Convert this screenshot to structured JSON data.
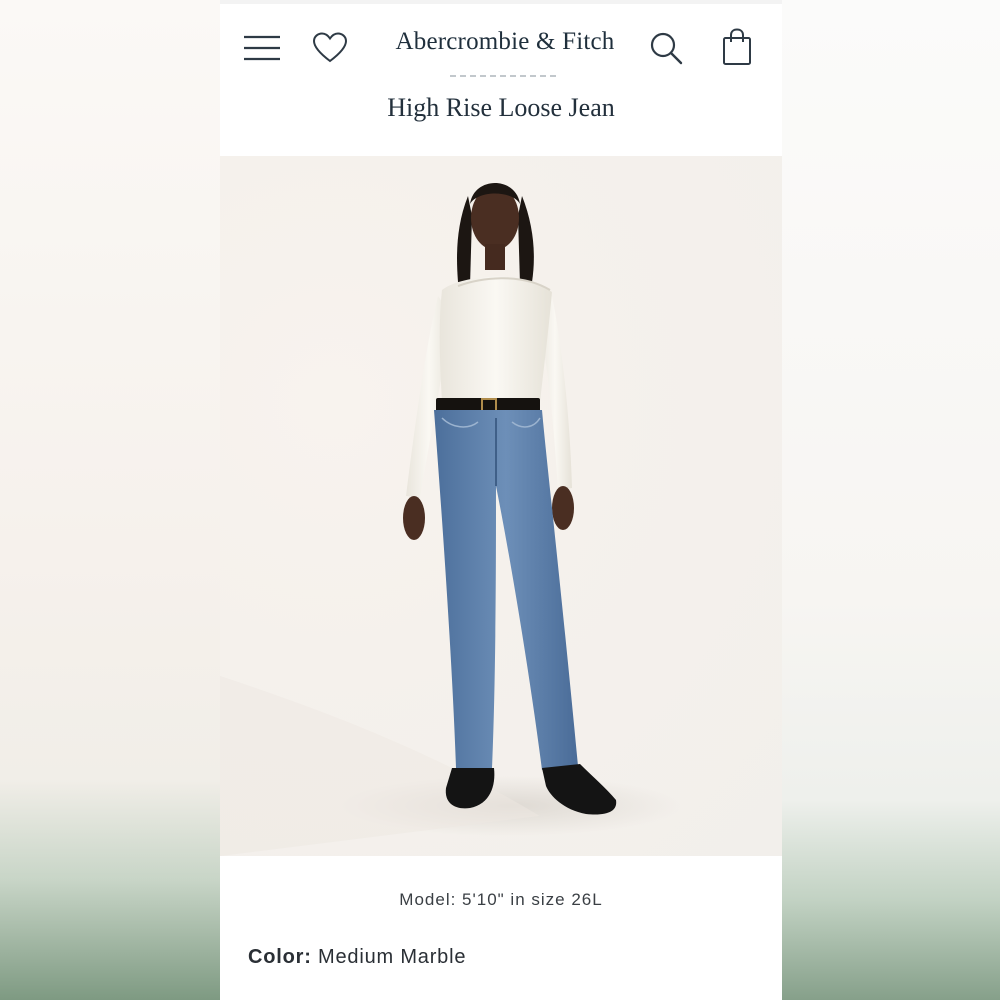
{
  "header": {
    "brand": "Abercrombie & Fitch",
    "icons": {
      "menu": "hamburger-menu-icon",
      "wishlist": "heart-icon",
      "search": "search-icon",
      "bag": "shopping-bag-icon"
    }
  },
  "product": {
    "title": "High Rise Loose Jean",
    "image_alt": "Model wearing high rise loose jeans with a white ribbed top, black belt and black loafers",
    "model_caption": "Model: 5'10\" in size 26L",
    "color_label": "Color:",
    "color_value": "Medium Marble"
  },
  "colors": {
    "text_primary": "#1f2f3c",
    "denim": "#5f82ad",
    "sweater": "#f4f1ea",
    "shoes": "#141414"
  }
}
